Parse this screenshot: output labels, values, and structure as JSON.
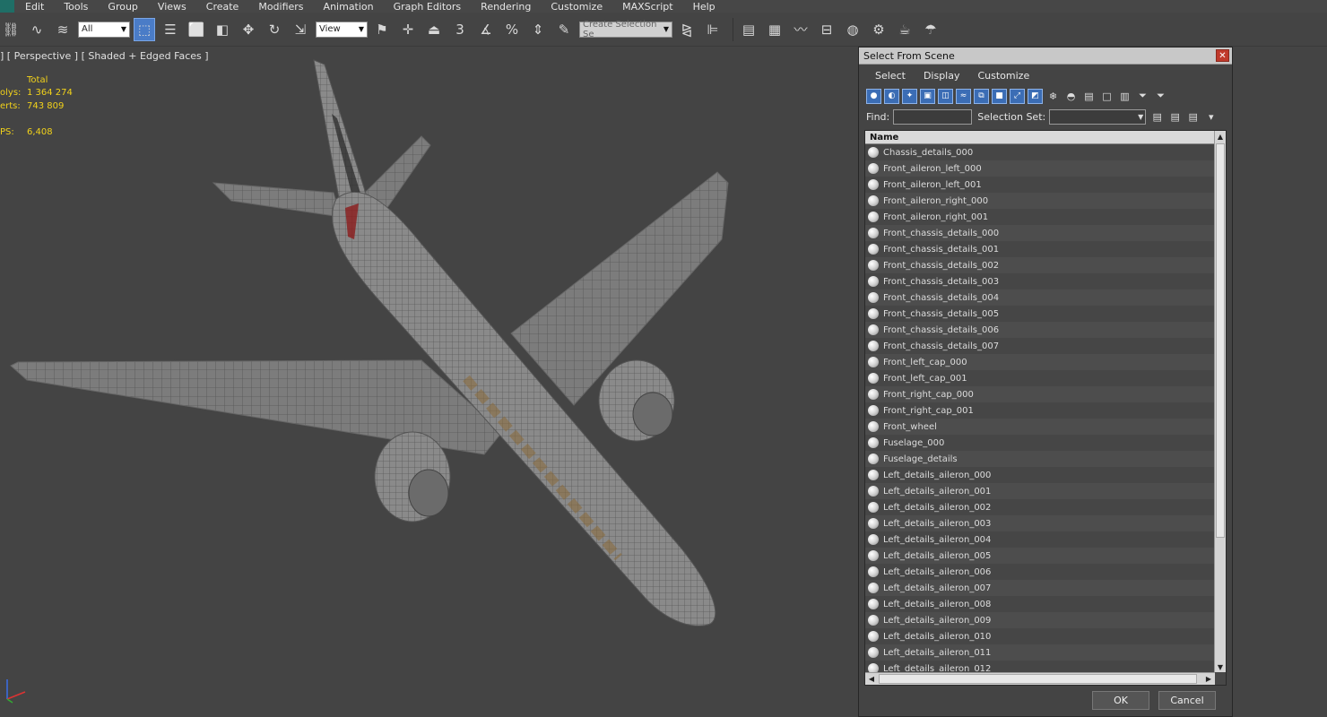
{
  "menubar": {
    "items": [
      "Edit",
      "Tools",
      "Group",
      "Views",
      "Create",
      "Modifiers",
      "Animation",
      "Graph Editors",
      "Rendering",
      "Customize",
      "MAXScript",
      "Help"
    ]
  },
  "toolbar": {
    "filter_value": "All",
    "ref_coord_value": "View",
    "snap_label": "3",
    "selection_set_placeholder": "Create Selection Se"
  },
  "viewport": {
    "label": "] [ Perspective ] [ Shaded + Edged Faces ]",
    "stats": {
      "header": "Total",
      "polys_label": "olys:",
      "polys_value": "1 364 274",
      "verts_label": "erts:",
      "verts_value": "743 809",
      "fps_label": "PS:",
      "fps_value": "6,408"
    }
  },
  "dialog": {
    "title": "Select From Scene",
    "close": "✕",
    "menu": [
      "Select",
      "Display",
      "Customize"
    ],
    "find_label": "Find:",
    "find_value": "",
    "selection_set_label": "Selection Set:",
    "column_header": "Name",
    "items": [
      "Chassis_details_000",
      "Front_aileron_left_000",
      "Front_aileron_left_001",
      "Front_aileron_right_000",
      "Front_aileron_right_001",
      "Front_chassis_details_000",
      "Front_chassis_details_001",
      "Front_chassis_details_002",
      "Front_chassis_details_003",
      "Front_chassis_details_004",
      "Front_chassis_details_005",
      "Front_chassis_details_006",
      "Front_chassis_details_007",
      "Front_left_cap_000",
      "Front_left_cap_001",
      "Front_right_cap_000",
      "Front_right_cap_001",
      "Front_wheel",
      "Fuselage_000",
      "Fuselage_details",
      "Left_details_aileron_000",
      "Left_details_aileron_001",
      "Left_details_aileron_002",
      "Left_details_aileron_003",
      "Left_details_aileron_004",
      "Left_details_aileron_005",
      "Left_details_aileron_006",
      "Left_details_aileron_007",
      "Left_details_aileron_008",
      "Left_details_aileron_009",
      "Left_details_aileron_010",
      "Left_details_aileron_011",
      "Left_details_aileron_012"
    ],
    "ok_label": "OK",
    "cancel_label": "Cancel"
  }
}
